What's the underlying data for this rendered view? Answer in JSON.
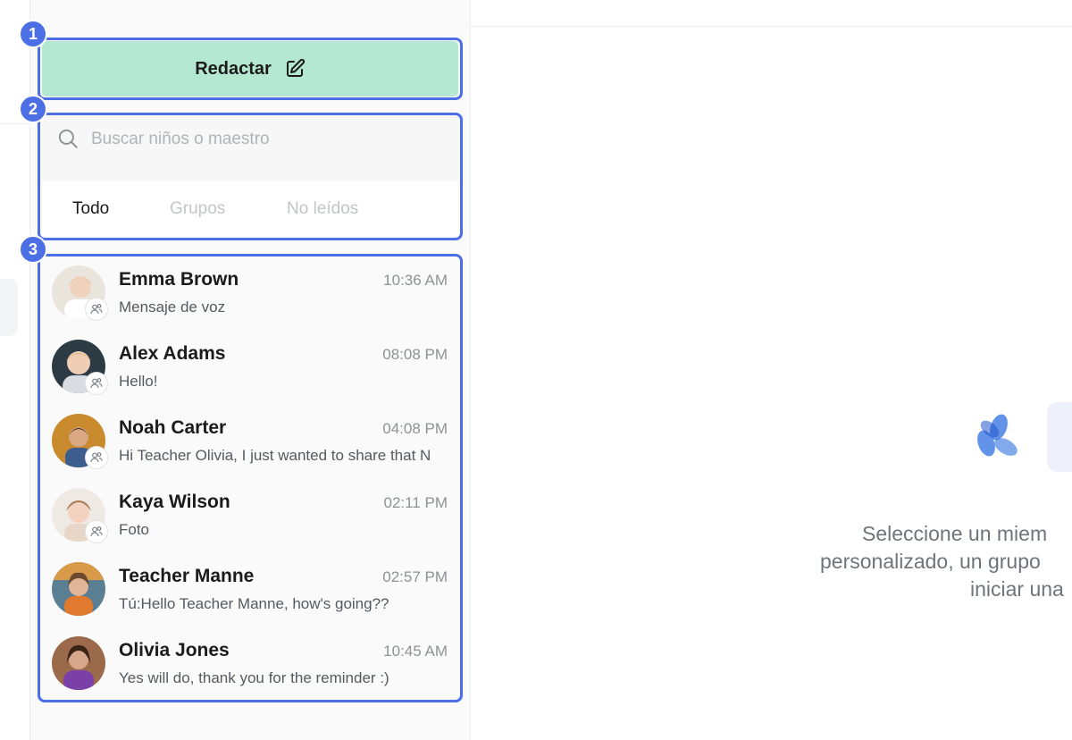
{
  "compose": {
    "label": "Redactar"
  },
  "search": {
    "placeholder": "Buscar niños o maestro"
  },
  "tabs": [
    {
      "label": "Todo",
      "active": true
    },
    {
      "label": "Grupos",
      "active": false
    },
    {
      "label": "No leídos",
      "active": false
    }
  ],
  "conversations": [
    {
      "name": "Emma Brown",
      "time": "10:36 AM",
      "preview": "Mensaje de voz"
    },
    {
      "name": "Alex Adams",
      "time": "08:08 PM",
      "preview": "Hello!"
    },
    {
      "name": "Noah Carter",
      "time": "04:08 PM",
      "preview": "Hi Teacher Olivia, I just wanted to share that N"
    },
    {
      "name": "Kaya Wilson",
      "time": "02:11 PM",
      "preview": "Foto"
    },
    {
      "name": "Teacher Manne",
      "time": "02:57 PM",
      "preview": "Tú:Hello Teacher Manne, how's going??"
    },
    {
      "name": "Olivia Jones",
      "time": "10:45 AM",
      "preview": "Yes will do, thank you for the reminder :)"
    }
  ],
  "callouts": [
    "1",
    "2",
    "3"
  ],
  "empty_state": {
    "line1": "Seleccione un miem",
    "line2": "personalizado, un grupo",
    "line3": "iniciar una"
  },
  "colors": {
    "accent": "#4d6fe6",
    "compose_bg": "#b5e8d2",
    "logo": "#2e6fe0"
  }
}
